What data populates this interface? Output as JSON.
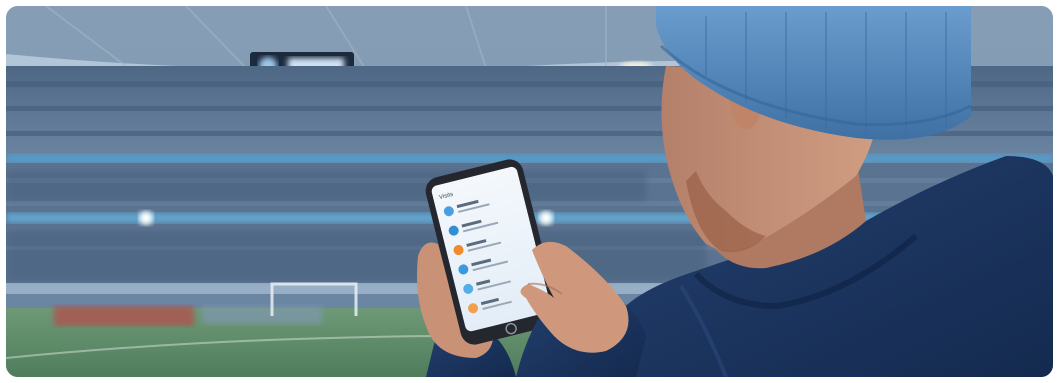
{
  "image": {
    "kind": "photo",
    "subject": "fan-using-phone-in-stadium"
  },
  "phone": {
    "header_title": "Visits",
    "list_items": [
      {
        "icon": "circle-icon",
        "color": "#4a9fe0"
      },
      {
        "icon": "circle-icon",
        "color": "#2f8fd6"
      },
      {
        "icon": "circle-icon",
        "color": "#f08a2a"
      },
      {
        "icon": "circle-icon",
        "color": "#3a9ae0"
      },
      {
        "icon": "circle-icon",
        "color": "#56aee6"
      },
      {
        "icon": "circle-icon",
        "color": "#f0a04a"
      }
    ]
  },
  "colors": {
    "sky": "#c9d8e6",
    "stands": "#5b7594",
    "pitch": "#5f8f6a",
    "hoodie": "#1f3763",
    "beanie": "#4e82b8",
    "skin": "#c58b6e",
    "phone_body": "#2a2d33",
    "phone_screen": "#eef4fa"
  }
}
